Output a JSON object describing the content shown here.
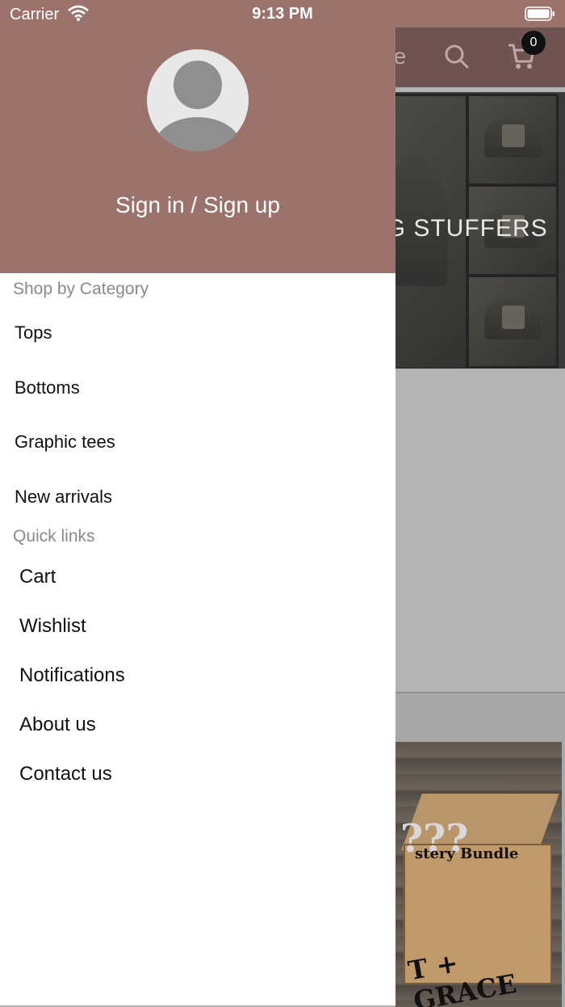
{
  "status_bar": {
    "carrier": "Carrier",
    "time": "9:13 PM"
  },
  "background": {
    "header_title_fragment": "ue",
    "cart_count": "0",
    "banner_text": "NG STUFFERS",
    "product_fragments": {
      "question_marks": "???",
      "label": "stery Bundle",
      "brand": "T + GRACE"
    }
  },
  "drawer": {
    "sign_in": "Sign in / Sign up",
    "category_section": "Shop by Category",
    "categories": [
      "Tops",
      "Bottoms",
      "Graphic tees",
      "New arrivals"
    ],
    "quick_links_section": "Quick links",
    "quick_links": [
      "Cart",
      "Wishlist",
      "Notifications",
      "About us",
      "Contact us"
    ]
  },
  "colors": {
    "header": "#9c726c",
    "app_header": "#6f5350",
    "overlay": "#b3b3b3"
  }
}
